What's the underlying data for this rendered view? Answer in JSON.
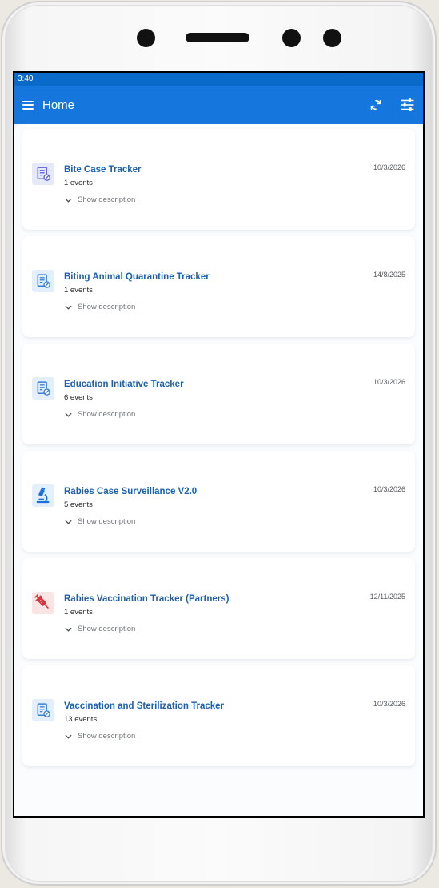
{
  "status_bar": {
    "time": "3:40"
  },
  "app_bar": {
    "title": "Home",
    "actions": [
      {
        "icon": "sync-icon",
        "label": "Sync"
      },
      {
        "icon": "filter-icon",
        "label": "Filter"
      }
    ]
  },
  "programs": [
    {
      "title": "Bite Case Tracker",
      "events": "1 events",
      "date": "10/3/2026",
      "description_toggle": "Show description",
      "icon": "form-icon",
      "icon_bg": "#e6e9f7",
      "icon_color": "#5b5fd6"
    },
    {
      "title": "Biting Animal Quarantine Tracker",
      "events": "1 events",
      "date": "14/8/2025",
      "description_toggle": "Show description",
      "icon": "form-icon",
      "icon_bg": "#e3effa",
      "icon_color": "#3b7fd3"
    },
    {
      "title": "Education Initiative Tracker",
      "events": "6 events",
      "date": "10/3/2026",
      "description_toggle": "Show description",
      "icon": "form-icon",
      "icon_bg": "#e3effa",
      "icon_color": "#3b7fd3"
    },
    {
      "title": "Rabies Case Surveillance V2.0",
      "events": "5 events",
      "date": "10/3/2026",
      "description_toggle": "Show description",
      "icon": "microscope-icon",
      "icon_bg": "#e3effa",
      "icon_color": "#1c6fd8"
    },
    {
      "title": "Rabies Vaccination Tracker (Partners)",
      "events": "1 events",
      "date": "12/11/2025",
      "description_toggle": "Show description",
      "icon": "syringe-icon",
      "icon_bg": "#fbe4e4",
      "icon_color": "#d8343c"
    },
    {
      "title": "Vaccination and Sterilization Tracker",
      "events": "13 events",
      "date": "10/3/2026",
      "description_toggle": "Show description",
      "icon": "form-icon",
      "icon_bg": "#e3effa",
      "icon_color": "#3b7fd3"
    }
  ],
  "colors": {
    "status_bar": "#0a6ac9",
    "app_bar": "#1576de",
    "program_title": "#1a5fb1"
  }
}
